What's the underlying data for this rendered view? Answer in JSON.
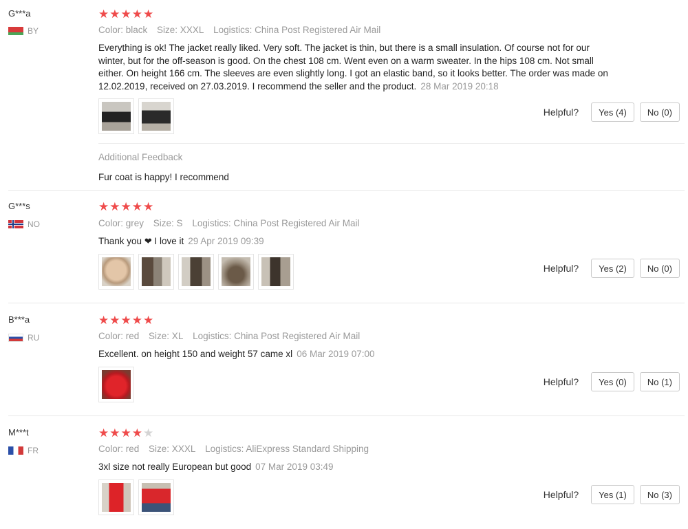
{
  "icons": {
    "star": "star-icon",
    "heart": "heart-icon"
  },
  "colors": {
    "star_on": "#ef4b4b",
    "star_off": "#d4d4d4",
    "meta_text": "#999999"
  },
  "helpful_label": "Helpful?",
  "reviews": [
    {
      "user": "G***a",
      "country": "BY",
      "rating": 5,
      "color": "Color: black",
      "size": "Size: XXXL",
      "logistics": "Logistics: China Post Registered Air Mail",
      "text": "Everything is ok! The jacket really liked. Very soft. The jacket is thin, but there is a small insulation. Of course not for our winter, but for the off-season is good. On the chest 108 cm. Went even on a warm sweater. In the hips 108 cm. Not small either. On height 166 cm. The sleeves are even slightly long. I got an elastic band, so it looks better. The order was made on 12.02.2019, received on 27.03.2019. I recommend the seller and the product.",
      "date": "28 Mar 2019 20:18",
      "thumbs": 2,
      "yes": "Yes (4)",
      "no": "No (0)",
      "additional_title": "Additional Feedback",
      "additional_text": "Fur coat is happy! I recommend"
    },
    {
      "user": "G***s",
      "country": "NO",
      "rating": 5,
      "color": "Color: grey",
      "size": "Size: S",
      "logistics": "Logistics: China Post Registered Air Mail",
      "text_before": "Thank you",
      "text_after": "I love it",
      "date": "29 Apr 2019 09:39",
      "thumbs": 5,
      "yes": "Yes (2)",
      "no": "No (0)"
    },
    {
      "user": "B***a",
      "country": "RU",
      "rating": 5,
      "color": "Color: red",
      "size": "Size: XL",
      "logistics": "Logistics: China Post Registered Air Mail",
      "text": "Excellent. on height 150 and weight 57 came xl",
      "date": "06 Mar 2019 07:00",
      "thumbs": 1,
      "yes": "Yes (0)",
      "no": "No (1)"
    },
    {
      "user": "M***t",
      "country": "FR",
      "rating": 4,
      "color": "Color: red",
      "size": "Size: XXXL",
      "logistics": "Logistics: AliExpress Standard Shipping",
      "text": "3xl size not really European but good",
      "date": "07 Mar 2019 03:49",
      "thumbs": 2,
      "yes": "Yes (1)",
      "no": "No (3)"
    }
  ]
}
